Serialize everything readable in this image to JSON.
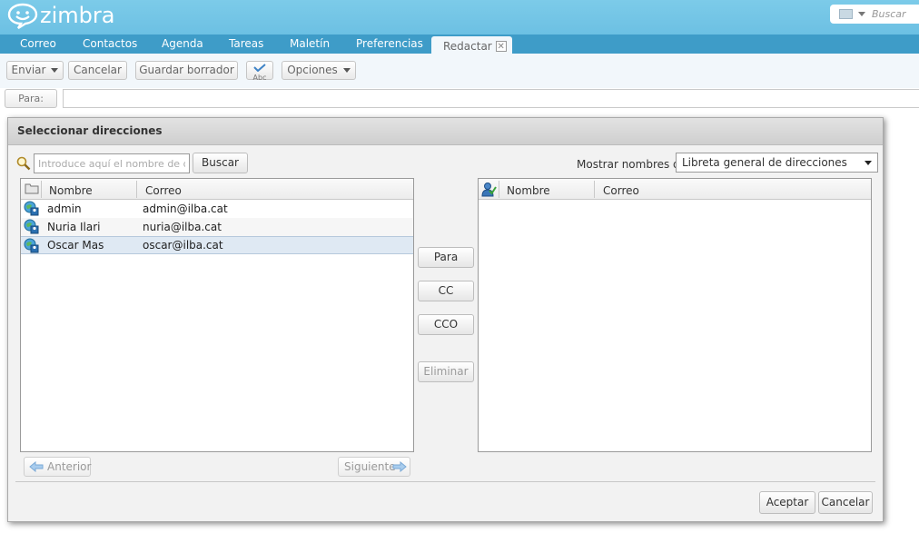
{
  "app": {
    "logo_text": "zimbra"
  },
  "search": {
    "placeholder": "Buscar"
  },
  "tabs": [
    {
      "label": "Correo"
    },
    {
      "label": "Contactos"
    },
    {
      "label": "Agenda"
    },
    {
      "label": "Tareas"
    },
    {
      "label": "Maletín"
    },
    {
      "label": "Preferencias"
    },
    {
      "label": "Redactar"
    }
  ],
  "toolbar": {
    "send_label": "Enviar",
    "cancel_label": "Cancelar",
    "save_draft_label": "Guardar borrador",
    "spell_label": "Abc",
    "options_label": "Opciones"
  },
  "compose": {
    "to_label": "Para:"
  },
  "dialog": {
    "title": "Seleccionar direcciones",
    "search_placeholder": "Introduce aquí el nombre de destinatario",
    "search_button": "Buscar",
    "show_names_label": "Mostrar nombres de:",
    "address_book": "Libreta general de direcciones",
    "left_columns": {
      "name": "Nombre",
      "email": "Correo"
    },
    "right_columns": {
      "name": "Nombre",
      "email": "Correo"
    },
    "contacts": [
      {
        "name": "admin",
        "email": "admin@ilba.cat"
      },
      {
        "name": "Nuria Ilari",
        "email": "nuria@ilba.cat"
      },
      {
        "name": "Oscar Mas",
        "email": "oscar@ilba.cat"
      }
    ],
    "add_to_label": "Para",
    "add_cc_label": "CC",
    "add_bcc_label": "CCO",
    "remove_label": "Eliminar",
    "prev_label": "Anterior",
    "next_label": "Siguiente",
    "ok_label": "Aceptar",
    "cancel_label": "Cancelar"
  },
  "colors": {
    "header": "#7ccbe9",
    "tabbar": "#3e9cc8",
    "selection": "#dfe9f3"
  }
}
